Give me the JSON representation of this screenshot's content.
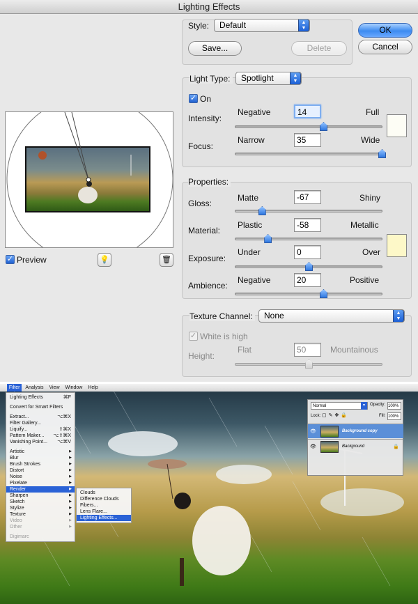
{
  "dialog": {
    "title": "Lighting Effects",
    "style": {
      "label": "Style:",
      "value": "Default"
    },
    "buttons": {
      "ok": "OK",
      "cancel": "Cancel",
      "save": "Save...",
      "delete": "Delete"
    },
    "light_type": {
      "label": "Light Type:",
      "value": "Spotlight"
    },
    "on": {
      "label": "On",
      "checked": true
    },
    "intensity": {
      "label": "Intensity:",
      "min_label": "Negative",
      "max_label": "Full",
      "value": "14",
      "slider_fraction": 0.6
    },
    "focus": {
      "label": "Focus:",
      "min_label": "Narrow",
      "max_label": "Wide",
      "value": "35",
      "slider_fraction": 1.0
    },
    "properties": {
      "title": "Properties:",
      "gloss": {
        "label": "Gloss:",
        "min_label": "Matte",
        "max_label": "Shiny",
        "value": "-67",
        "slider_fraction": 0.18
      },
      "material": {
        "label": "Material:",
        "min_label": "Plastic",
        "max_label": "Metallic",
        "value": "-58",
        "slider_fraction": 0.22
      },
      "exposure": {
        "label": "Exposure:",
        "min_label": "Under",
        "max_label": "Over",
        "value": "0",
        "slider_fraction": 0.5
      },
      "ambience": {
        "label": "Ambience:",
        "min_label": "Negative",
        "max_label": "Positive",
        "value": "20",
        "slider_fraction": 0.6
      }
    },
    "texture": {
      "label": "Texture Channel:",
      "value": "None",
      "white_is_high": "White is high",
      "height": {
        "label": "Height:",
        "min_label": "Flat",
        "max_label": "Mountainous",
        "value": "50",
        "slider_fraction": 0.5
      }
    },
    "preview": {
      "label": "Preview",
      "checked": true
    },
    "colors": {
      "light_color": "#fdfdf5",
      "material_color": "#fdf8c8",
      "accent": "#2a62d6"
    }
  },
  "photoshop": {
    "menubar": [
      "Filter",
      "Analysis",
      "View",
      "Window",
      "Help"
    ],
    "filter_menu": {
      "top": [
        {
          "label": "Lighting Effects",
          "shortcut": "⌘F"
        }
      ],
      "convert": "Convert for Smart Filters",
      "group2": [
        {
          "label": "Extract...",
          "shortcut": "⌥⌘X"
        },
        {
          "label": "Filter Gallery...",
          "shortcut": ""
        },
        {
          "label": "Liquify...",
          "shortcut": "⇧⌘X"
        },
        {
          "label": "Pattern Maker...",
          "shortcut": "⌥⇧⌘X"
        },
        {
          "label": "Vanishing Point...",
          "shortcut": "⌥⌘V"
        }
      ],
      "submenus": [
        "Artistic",
        "Blur",
        "Brush Strokes",
        "Distort",
        "Noise",
        "Pixelate",
        "Render",
        "Sharpen",
        "Sketch",
        "Stylize",
        "Texture",
        "Video",
        "Other"
      ],
      "bottom": [
        "Digimarc"
      ]
    },
    "render_menu": [
      "Clouds",
      "Difference Clouds",
      "Fibers...",
      "Lens Flare...",
      "Lighting Effects..."
    ],
    "layers": {
      "blend_mode": "Normal",
      "opacity_label": "Opacity:",
      "opacity": "100%",
      "lock_label": "Lock:",
      "fill_label": "Fill:",
      "fill": "100%",
      "items": [
        "Background copy",
        "Background"
      ]
    }
  }
}
